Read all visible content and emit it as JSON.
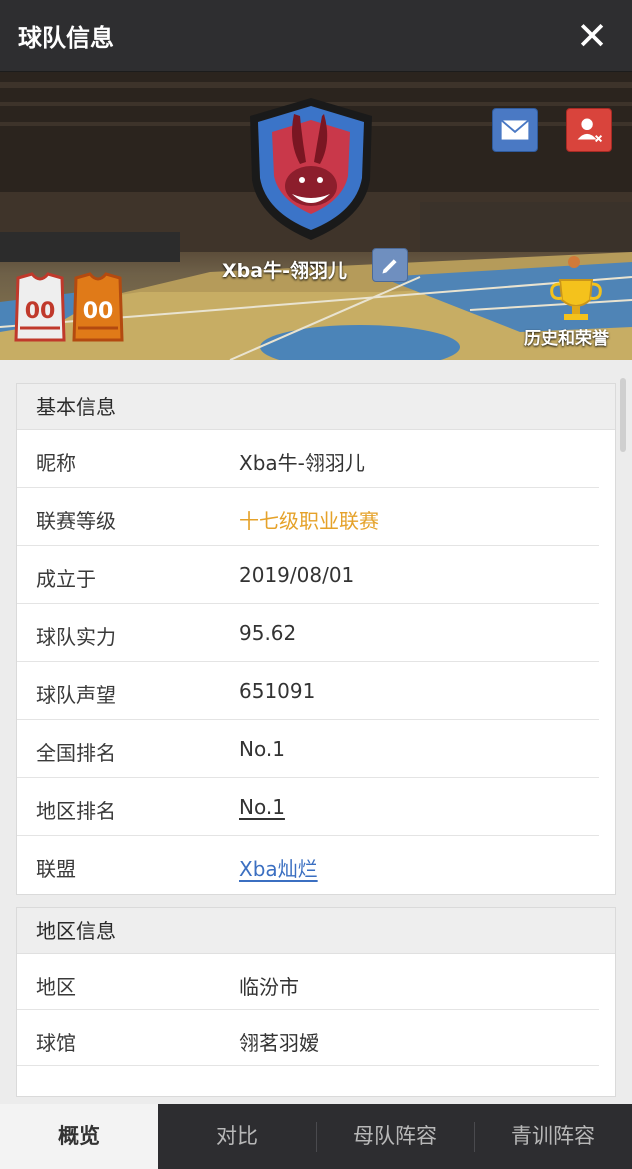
{
  "header": {
    "title": "球队信息",
    "close_icon": "close-icon"
  },
  "team": {
    "name": "Xba牛-翎羽儿",
    "jersey_home_number": "00",
    "jersey_away_number": "00",
    "honor_label": "历史和荣誉"
  },
  "basic_info": {
    "title": "基本信息",
    "rows": [
      {
        "label": "昵称",
        "value": "Xba牛-翎羽儿"
      },
      {
        "label": "联赛等级",
        "value": "十七级职业联赛"
      },
      {
        "label": "成立于",
        "value": "2019/08/01"
      },
      {
        "label": "球队实力",
        "value": "95.62"
      },
      {
        "label": "球队声望",
        "value": "651091"
      },
      {
        "label": "全国排名",
        "value": "No.1"
      },
      {
        "label": "地区排名",
        "value": "No.1"
      },
      {
        "label": "联盟",
        "value": "Xba灿烂"
      }
    ]
  },
  "region_info": {
    "title": "地区信息",
    "rows": [
      {
        "label": "地区",
        "value": "临汾市"
      },
      {
        "label": "球馆",
        "value": "翎茗羽嫒"
      }
    ]
  },
  "tabs": [
    {
      "label": "概览",
      "active": true
    },
    {
      "label": "对比",
      "active": false
    },
    {
      "label": "母队阵容",
      "active": false
    },
    {
      "label": "青训阵容",
      "active": false
    }
  ],
  "colors": {
    "accent_gold": "#e5a22a",
    "link_blue": "#3b6fc1",
    "topbar": "#2e2e30"
  }
}
